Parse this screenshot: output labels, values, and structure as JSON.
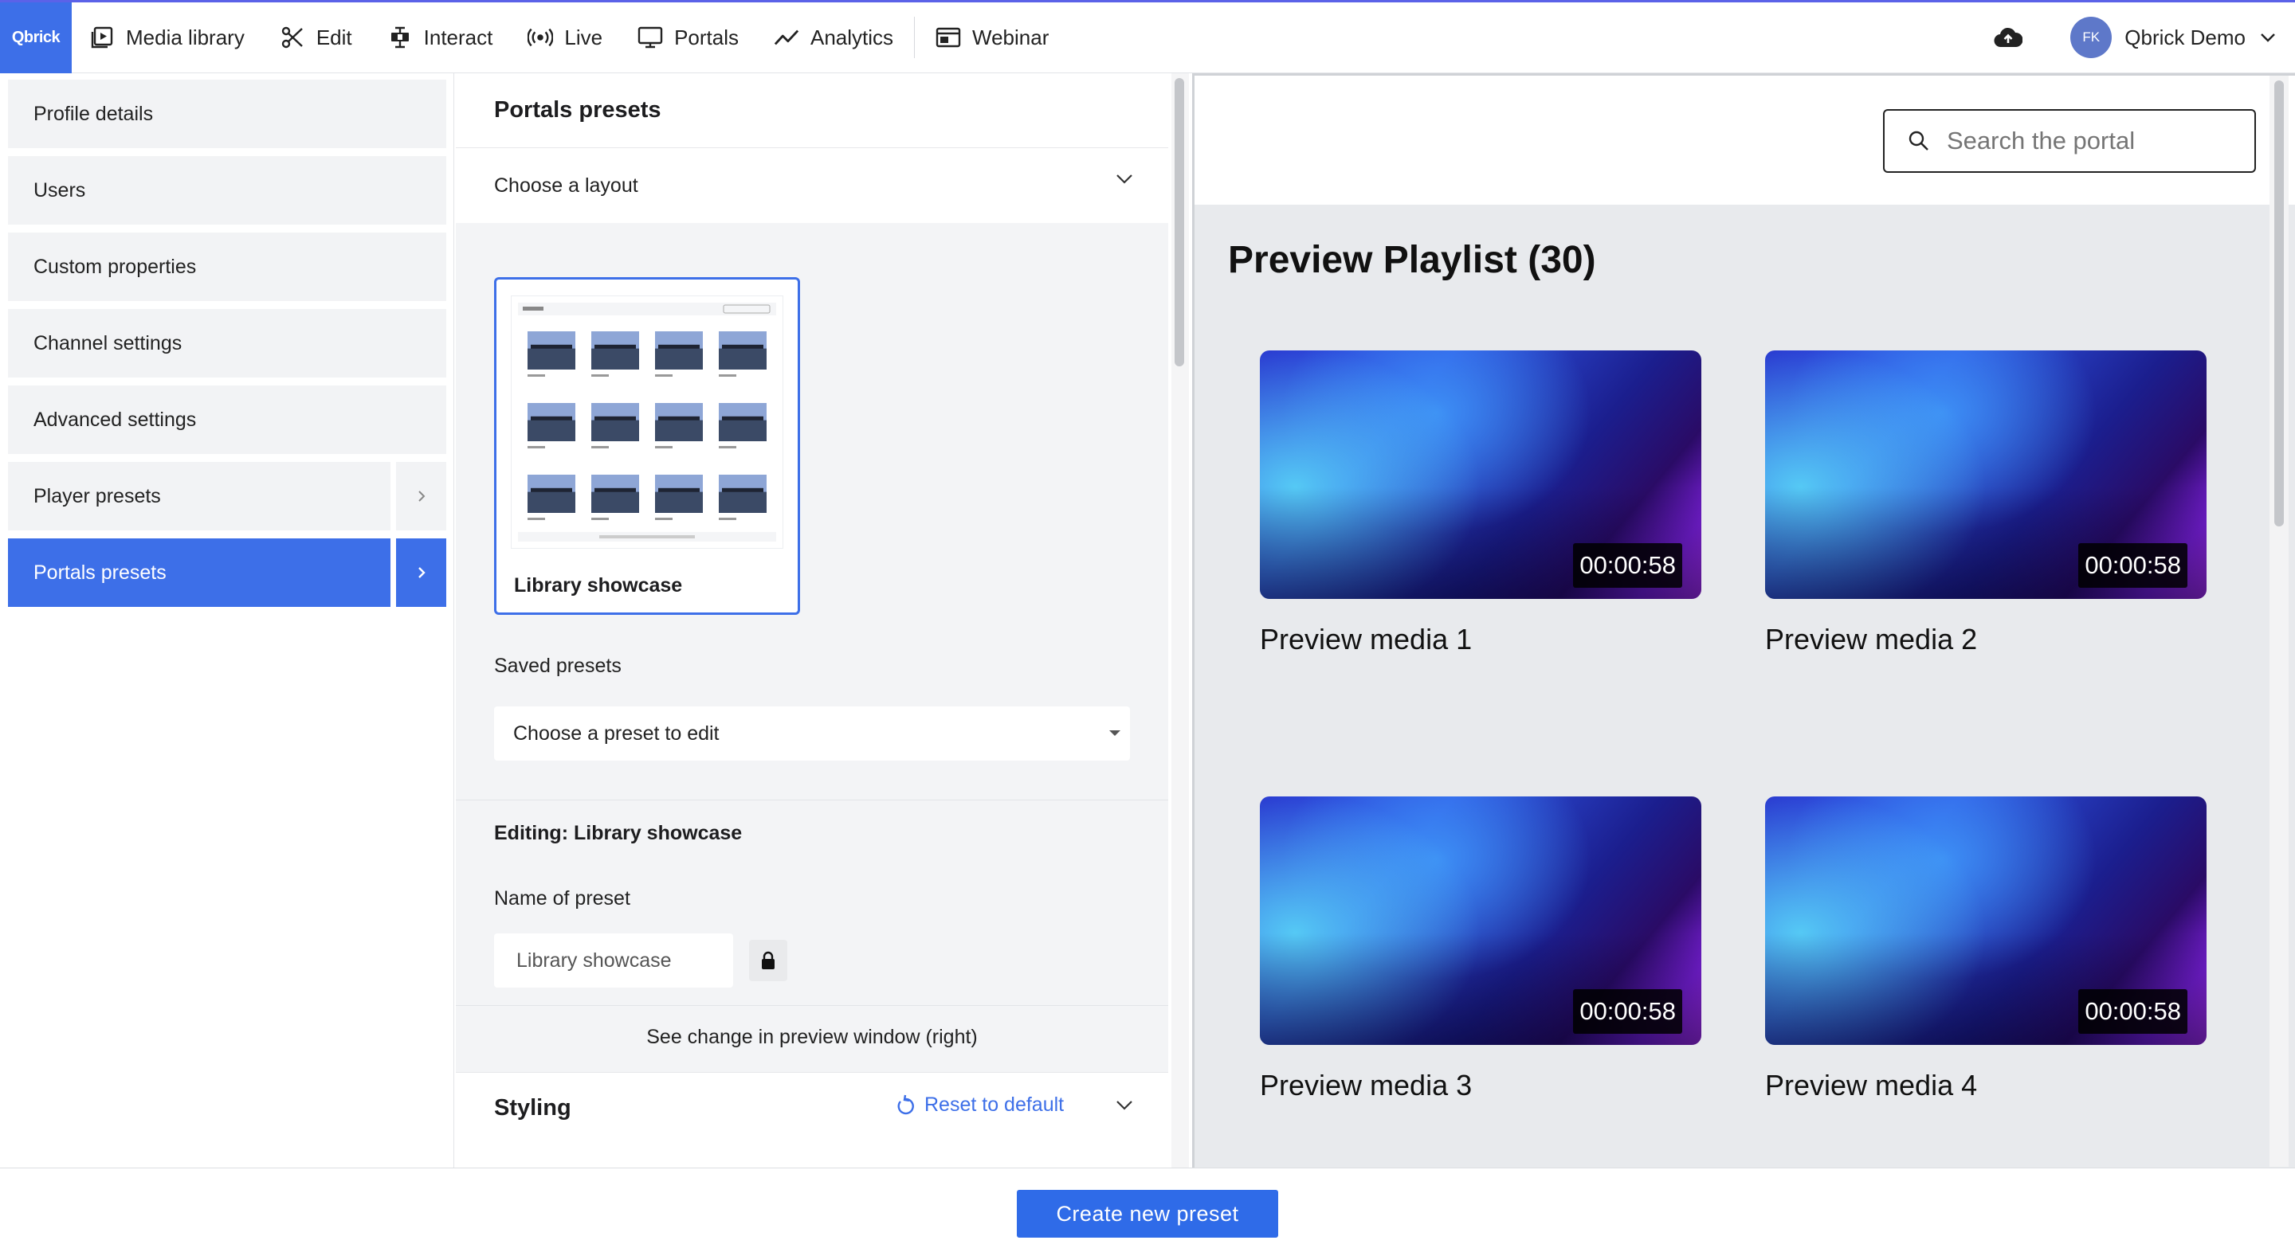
{
  "app": {
    "logo_text": "Qbrick"
  },
  "nav": {
    "items": [
      {
        "label": "Media library",
        "icon": "media-library-icon"
      },
      {
        "label": "Edit",
        "icon": "scissors-icon"
      },
      {
        "label": "Interact",
        "icon": "interact-icon"
      },
      {
        "label": "Live",
        "icon": "broadcast-icon"
      },
      {
        "label": "Portals",
        "icon": "monitor-icon"
      },
      {
        "label": "Analytics",
        "icon": "trend-line-icon"
      },
      {
        "label": "Webinar",
        "icon": "webinar-icon"
      }
    ]
  },
  "user": {
    "initials": "FK",
    "name": "Qbrick Demo"
  },
  "sidebar": {
    "items": [
      {
        "label": "Profile details"
      },
      {
        "label": "Users"
      },
      {
        "label": "Custom properties"
      },
      {
        "label": "Channel settings"
      },
      {
        "label": "Advanced settings"
      },
      {
        "label": "Player presets"
      },
      {
        "label": "Portals presets",
        "active": true
      }
    ]
  },
  "panel": {
    "title": "Portals presets",
    "layout_dropdown": "Choose a layout",
    "layout_card_label": "Library showcase",
    "saved_presets_label": "Saved presets",
    "preset_select_value": "Choose a preset to edit",
    "editing_label": "Editing: Library showcase",
    "name_label": "Name of preset",
    "name_value": "Library showcase",
    "hint": "See change in preview window (right)",
    "styling_label": "Styling",
    "reset_label": "Reset to default"
  },
  "preview": {
    "search_placeholder": "Search the portal",
    "playlist_title": "Preview Playlist (30)",
    "media": [
      {
        "title": "Preview media 1",
        "duration": "00:00:58"
      },
      {
        "title": "Preview media 2",
        "duration": "00:00:58"
      },
      {
        "title": "Preview media 3",
        "duration": "00:00:58"
      },
      {
        "title": "Preview media 4",
        "duration": "00:00:58"
      }
    ]
  },
  "footer": {
    "create_label": "Create new preset"
  },
  "colors": {
    "accent": "#3d6fe8",
    "top_border": "#5b62e8"
  }
}
